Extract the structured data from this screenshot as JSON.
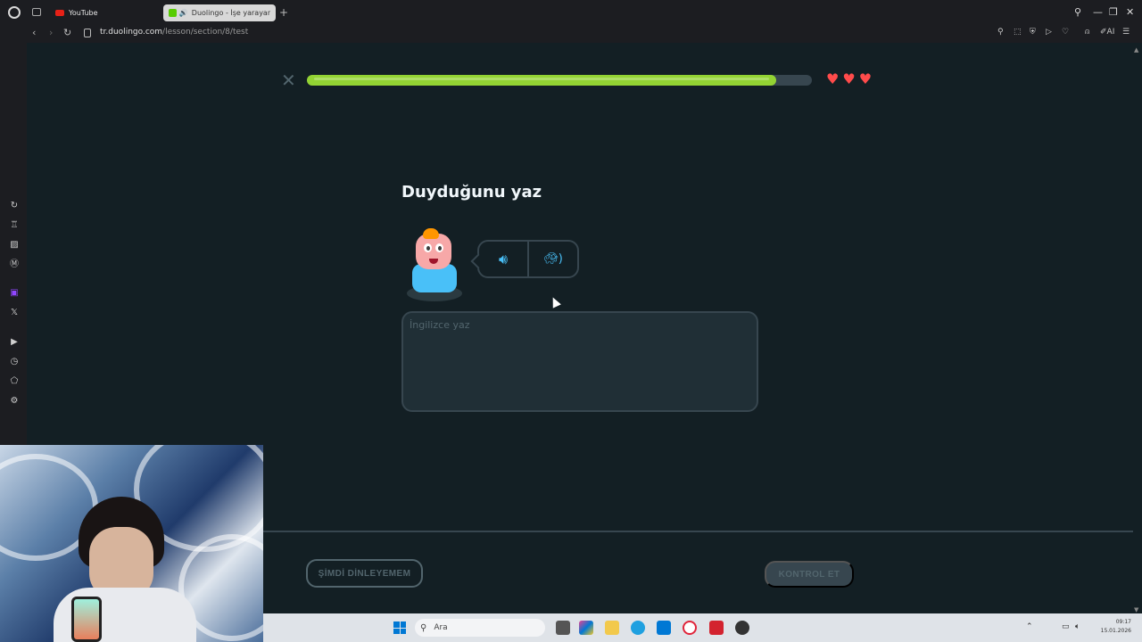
{
  "browser": {
    "tabs": [
      {
        "label": "YouTube"
      },
      {
        "label": "Duolingo - İşe yarayan"
      }
    ],
    "new_tab_symbol": "+",
    "url_host": "tr.duolingo.com",
    "url_path": "/lesson/section/8/test",
    "ai_label": "AI"
  },
  "lesson": {
    "progress_fraction": 0.93,
    "hearts": 3,
    "title": "Duyduğunu yaz",
    "answer_placeholder": "İngilizce yaz",
    "answer_value": "",
    "skip_label": "ŞİMDİ DİNLEYEMEM",
    "check_label": "KONTROL ET"
  },
  "taskbar": {
    "search_label": "Ara",
    "time": "09:17",
    "date": "15.01.2026"
  },
  "colors": {
    "background": "#131f24",
    "progress_fill": "#93d333",
    "progress_track": "#37464f",
    "heart": "#ff4b4b",
    "audio_icon": "#49c0f8",
    "border": "#37464f"
  },
  "icons": {
    "close": "close-icon",
    "heart": "heart-icon",
    "speaker": "speaker-icon",
    "turtle": "turtle-slow-icon"
  }
}
